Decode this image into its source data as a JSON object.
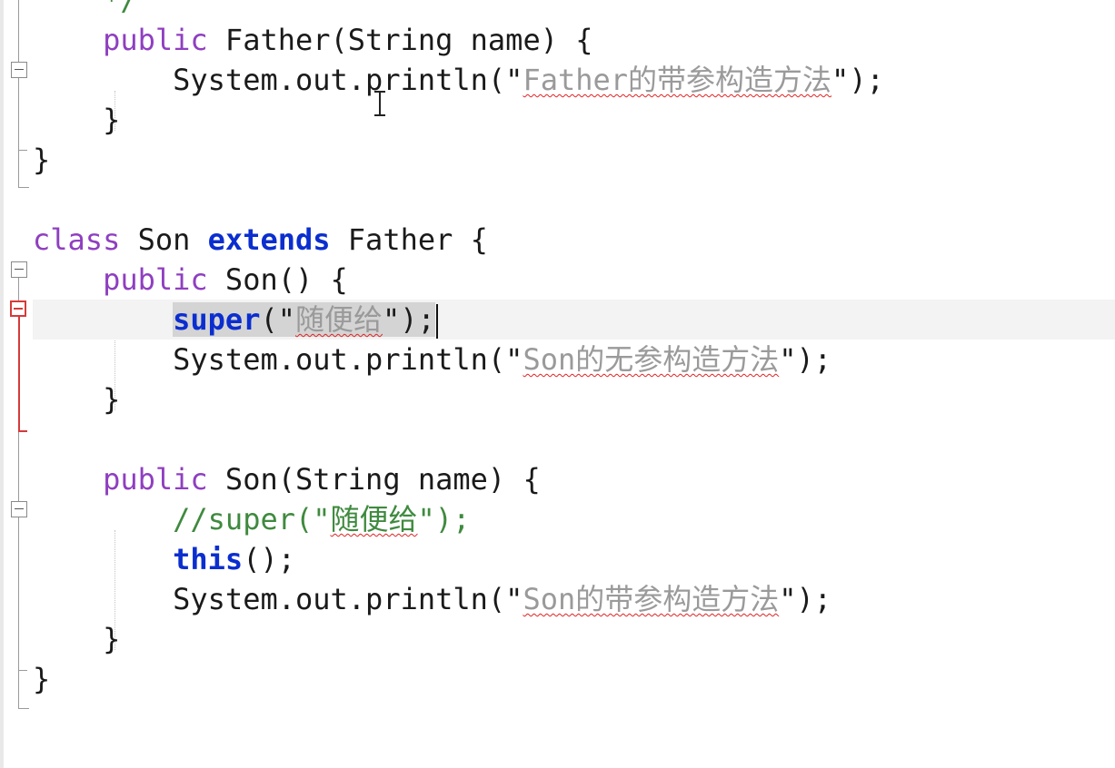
{
  "editor": {
    "lines": [
      {
        "id": "l0",
        "indent": "    ",
        "tokens": [
          {
            "t": "*/",
            "c": "cm"
          }
        ]
      },
      {
        "id": "l1",
        "indent": "    ",
        "tokens": [
          {
            "t": "public",
            "c": "kw"
          },
          {
            "t": " Father(String name) {",
            "c": "ty"
          }
        ]
      },
      {
        "id": "l2",
        "indent": "        ",
        "tokens": [
          {
            "t": "System.out.println(\"",
            "c": "ty"
          },
          {
            "t": "Father的带参构造方法",
            "c": "str zh"
          },
          {
            "t": "\");",
            "c": "ty"
          }
        ]
      },
      {
        "id": "l3",
        "indent": "    ",
        "tokens": [
          {
            "t": "}",
            "c": "ty"
          }
        ]
      },
      {
        "id": "l4",
        "indent": "",
        "tokens": [
          {
            "t": "}",
            "c": "ty"
          }
        ]
      },
      {
        "id": "l5",
        "indent": "",
        "tokens": []
      },
      {
        "id": "l6",
        "indent": "",
        "tokens": [
          {
            "t": "class",
            "c": "kw"
          },
          {
            "t": " Son ",
            "c": "ty"
          },
          {
            "t": "extends",
            "c": "kwb"
          },
          {
            "t": " Father {",
            "c": "ty"
          }
        ]
      },
      {
        "id": "l7",
        "indent": "    ",
        "tokens": [
          {
            "t": "public",
            "c": "kw"
          },
          {
            "t": " Son() {",
            "c": "ty"
          }
        ]
      },
      {
        "id": "l8",
        "indent": "        ",
        "current": true,
        "tokens": [
          {
            "t": "super",
            "c": "kwb sel"
          },
          {
            "t": "(\"",
            "c": "ty sel"
          },
          {
            "t": "随便给",
            "c": "str zh sel"
          },
          {
            "t": "\");",
            "c": "ty sel"
          },
          {
            "t": "",
            "c": "caret"
          }
        ]
      },
      {
        "id": "l9",
        "indent": "        ",
        "tokens": [
          {
            "t": "System.out.println(\"",
            "c": "ty"
          },
          {
            "t": "Son的无参构造方法",
            "c": "str zh"
          },
          {
            "t": "\");",
            "c": "ty"
          }
        ]
      },
      {
        "id": "l10",
        "indent": "    ",
        "tokens": [
          {
            "t": "}",
            "c": "ty"
          }
        ]
      },
      {
        "id": "l11",
        "indent": "",
        "tokens": []
      },
      {
        "id": "l12",
        "indent": "    ",
        "tokens": [
          {
            "t": "public",
            "c": "kw"
          },
          {
            "t": " Son(String name) {",
            "c": "ty"
          }
        ]
      },
      {
        "id": "l13",
        "indent": "        ",
        "tokens": [
          {
            "t": "//super(\"",
            "c": "cm"
          },
          {
            "t": "随便给",
            "c": "cm zh"
          },
          {
            "t": "\");",
            "c": "cm"
          }
        ]
      },
      {
        "id": "l14",
        "indent": "        ",
        "tokens": [
          {
            "t": "this",
            "c": "kwb"
          },
          {
            "t": "();",
            "c": "ty"
          }
        ]
      },
      {
        "id": "l15",
        "indent": "        ",
        "tokens": [
          {
            "t": "System.out.println(\"",
            "c": "ty"
          },
          {
            "t": "Son的带参构造方法",
            "c": "str zh"
          },
          {
            "t": "\");",
            "c": "ty"
          }
        ]
      },
      {
        "id": "l16",
        "indent": "    ",
        "tokens": [
          {
            "t": "}",
            "c": "ty"
          }
        ]
      },
      {
        "id": "l17",
        "indent": "",
        "tokens": [
          {
            "t": "}",
            "c": "ty"
          }
        ]
      }
    ]
  },
  "colors": {
    "keyword": "#8f3fc0",
    "keyword_bold": "#0b2ecf",
    "string": "#9a9a9a",
    "comment": "#3f8a3f",
    "spell_underline": "#e02222",
    "fold_active": "#d63a3a"
  },
  "icons": [
    "fold-collapse-icon",
    "text-cursor-icon"
  ]
}
